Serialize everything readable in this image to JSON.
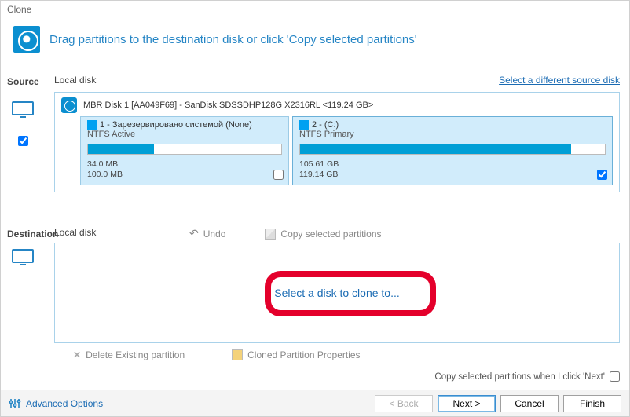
{
  "window": {
    "title": "Clone"
  },
  "header": {
    "instruction": "Drag partitions to the destination disk or click 'Copy selected partitions'"
  },
  "source": {
    "label": "Source",
    "local_disk": "Local disk",
    "select_different": "Select a different source disk",
    "disk_label": "MBR Disk 1 [AA049F69] - SanDisk SDSSDHP128G X2316RL  <119.24 GB>",
    "partitions": [
      {
        "title": "1 - Зарезервировано системой (None)",
        "sub": "NTFS Active",
        "used": "34.0 MB",
        "total": "100.0 MB",
        "fill_pct": 34,
        "checked": false
      },
      {
        "title": "2 -  (C:)",
        "sub": "NTFS Primary",
        "used": "105.61 GB",
        "total": "119.14 GB",
        "fill_pct": 89,
        "checked": true
      }
    ]
  },
  "destination": {
    "label": "Destination",
    "local_disk": "Local disk",
    "undo": "Undo",
    "copy": "Copy selected partitions",
    "select_disk": "Select a disk to clone to...",
    "delete_existing": "Delete Existing partition",
    "cloned_props": "Cloned Partition Properties"
  },
  "hint": {
    "text": "Copy selected partitions when I click 'Next'"
  },
  "footer": {
    "advanced": "Advanced Options",
    "back": "< Back",
    "next": "Next >",
    "cancel": "Cancel",
    "finish": "Finish"
  }
}
